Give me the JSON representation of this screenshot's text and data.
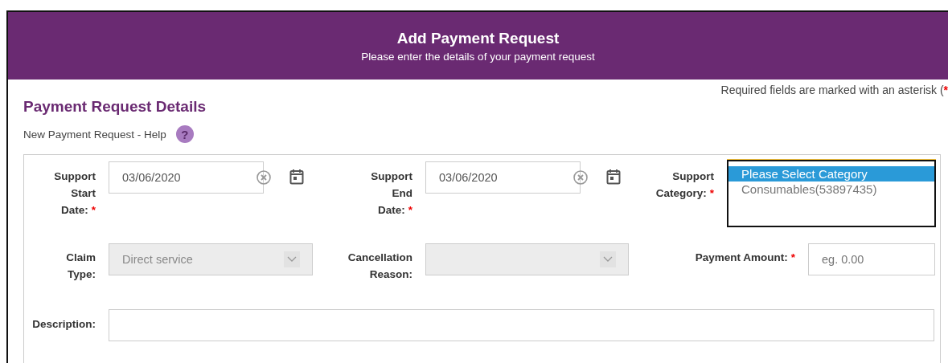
{
  "header": {
    "title": "Add Payment Request",
    "subtitle": "Please enter the details of your payment request"
  },
  "required_note": {
    "text": "Required fields are marked with an asterisk (",
    "mark": "*"
  },
  "section": {
    "title": "Payment Request Details",
    "help": "New Payment Request - Help",
    "help_icon": "?"
  },
  "rows": [
    {
      "fields": [
        {
          "kind": "date",
          "label": "Support Start Date:",
          "required": true,
          "value": "03/06/2020"
        },
        {
          "kind": "date",
          "label": "Support End Date:",
          "required": true,
          "value": "03/06/2020"
        },
        {
          "kind": "listbox",
          "label": "Support Category:",
          "required": true,
          "options": [
            {
              "label": "Please Select Category",
              "selected": true
            },
            {
              "label": "Consumables(53897435)",
              "selected": false
            }
          ]
        }
      ]
    },
    {
      "fields": [
        {
          "kind": "select",
          "label": "Claim Type:",
          "required": false,
          "value": "Direct service",
          "disabled": true
        },
        {
          "kind": "select",
          "label": "Cancellation Reason:",
          "required": false,
          "disabled": true
        },
        {
          "kind": "text",
          "label": "Payment Amount:",
          "required": true,
          "placeholder": "eg. 0.00"
        }
      ]
    },
    {
      "fields": [
        {
          "kind": "wide",
          "label": "Description:",
          "required": false
        }
      ]
    }
  ]
}
